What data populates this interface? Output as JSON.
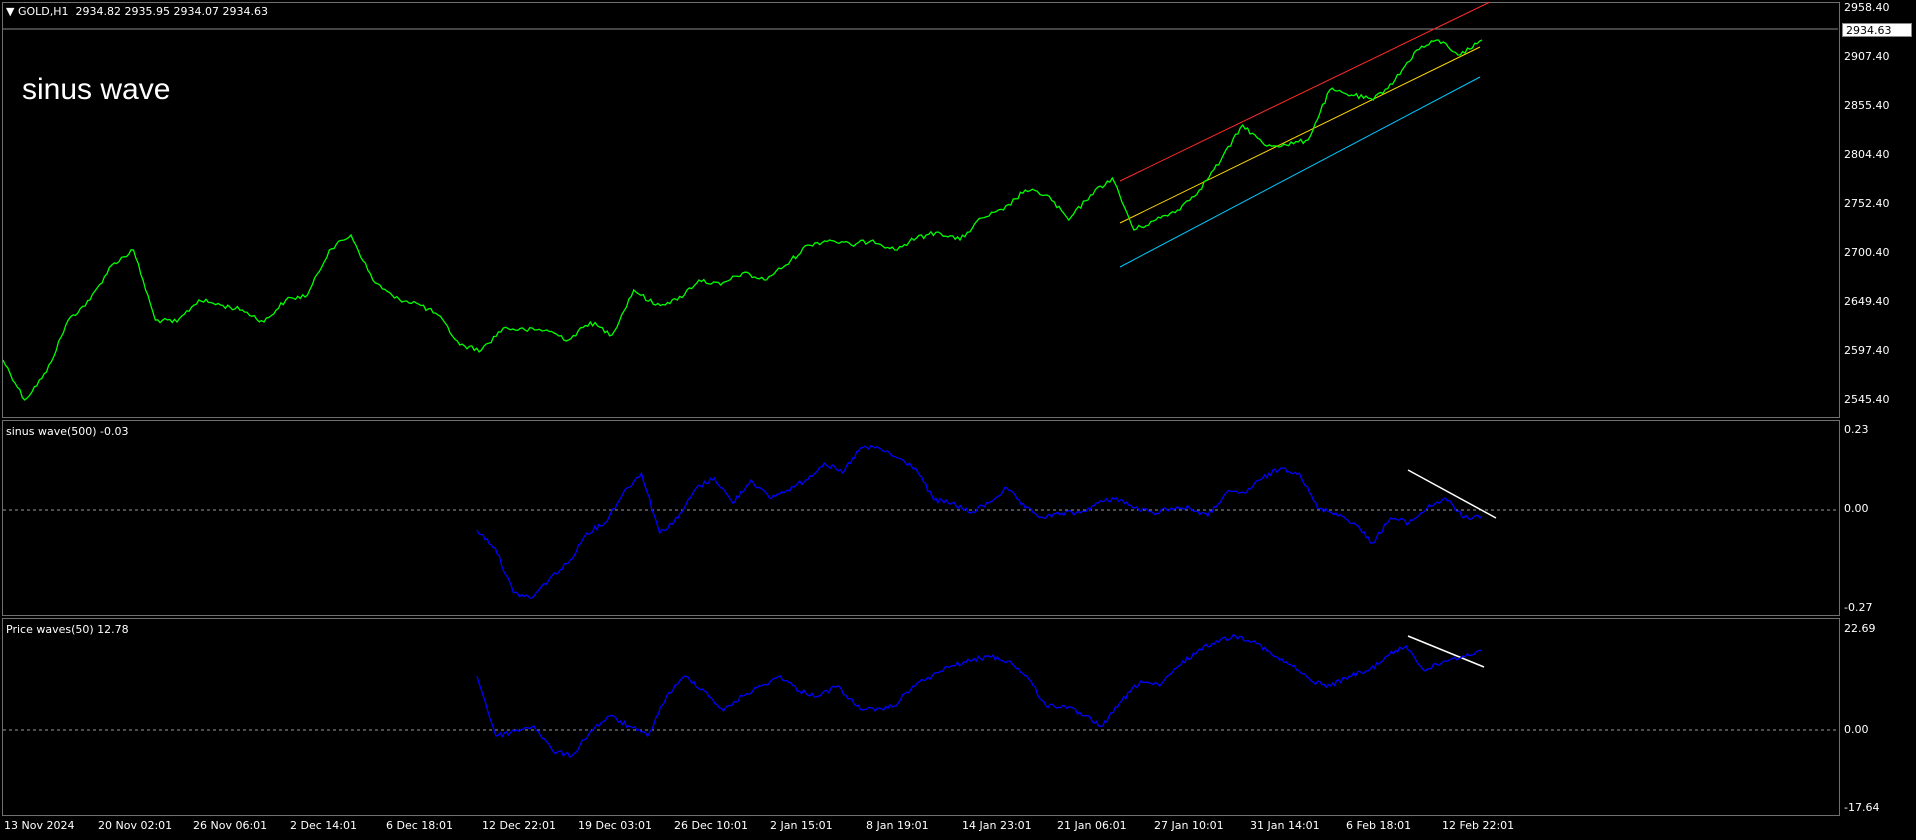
{
  "main": {
    "symbol": "GOLD,H1",
    "ohlc": "2934.82 2935.95 2934.07 2934.63",
    "overlay_text": "sinus wave",
    "current_price": "2934.63",
    "price_levels": [
      "2958.40",
      "2907.40",
      "2855.40",
      "2804.40",
      "2752.40",
      "2700.40",
      "2649.40",
      "2597.40",
      "2545.40"
    ],
    "line_color": "#00ff00",
    "channel_colors": {
      "upper": "#ff2a2a",
      "middle": "#ffd700",
      "lower": "#00c8ff"
    }
  },
  "indicator1": {
    "label": "sinus wave(500) -0.03",
    "levels": [
      "0.23",
      "0.00",
      "-0.27"
    ],
    "line_color": "#0000ff"
  },
  "indicator2": {
    "label": "Price waves(50) 12.78",
    "levels": [
      "22.69",
      "0.00",
      "-17.64"
    ],
    "line_color": "#0000ff"
  },
  "time_axis": [
    "13 Nov 2024",
    "20 Nov 02:01",
    "26 Nov 06:01",
    "2 Dec 14:01",
    "6 Dec 18:01",
    "12 Dec 22:01",
    "19 Dec 03:01",
    "26 Dec 10:01",
    "2 Jan 15:01",
    "8 Jan 19:01",
    "14 Jan 23:01",
    "21 Jan 06:01",
    "27 Jan 10:01",
    "31 Jan 14:01",
    "6 Feb 18:01",
    "12 Feb 22:01"
  ]
}
